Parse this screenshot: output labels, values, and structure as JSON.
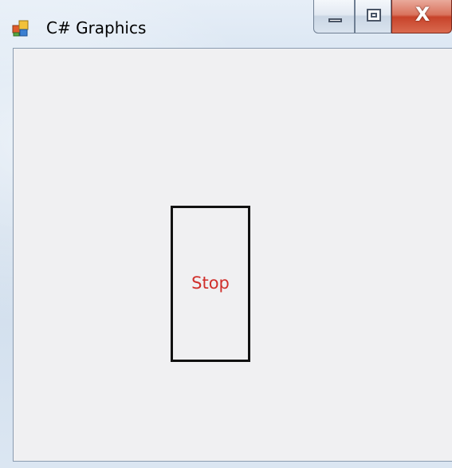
{
  "window": {
    "title": "C# Graphics",
    "icon": "app-window-icon"
  },
  "caption_buttons": {
    "minimize_icon": "minimize-icon",
    "maximize_icon": "maximize-icon",
    "close_icon": "close-icon",
    "close_glyph": "X"
  },
  "canvas": {
    "rect_label": "Stop",
    "rect_label_color": "#d0302c",
    "rect_stroke_color": "#111111",
    "background_color": "#f0f0f2"
  }
}
